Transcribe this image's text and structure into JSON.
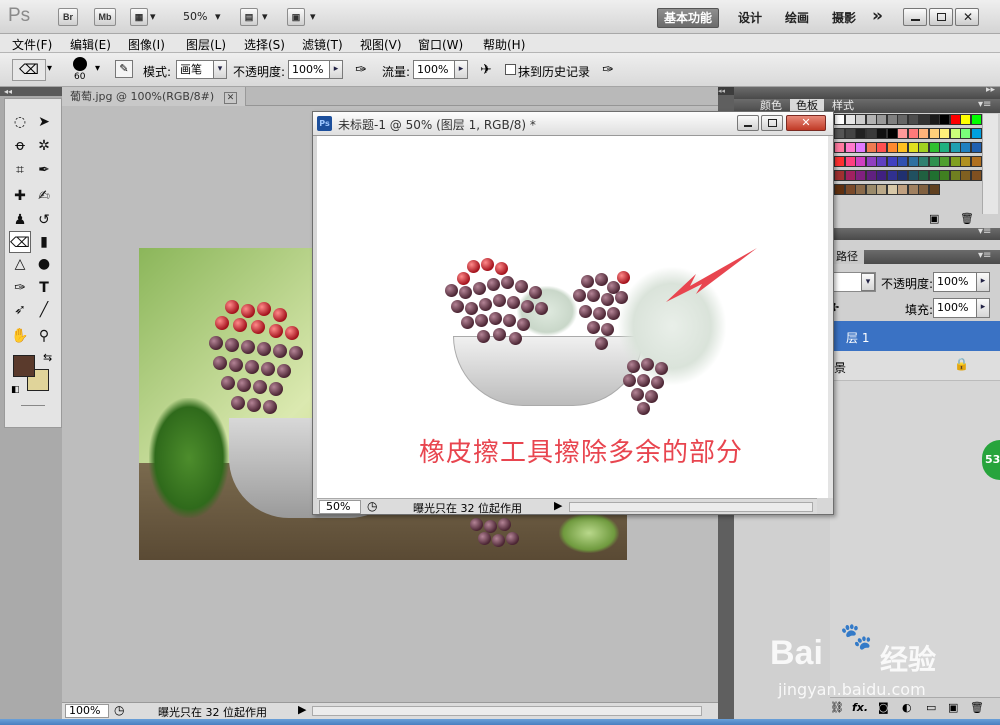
{
  "app": {
    "logo": "Ps",
    "bridge_btn": "Br",
    "minibridge_btn": "Mb",
    "zoom_level": "50%",
    "workspaces": [
      "基本功能",
      "设计",
      "绘画",
      "摄影"
    ],
    "more": "»"
  },
  "menu": [
    "文件(F)",
    "编辑(E)",
    "图像(I)",
    "图层(L)",
    "选择(S)",
    "滤镜(T)",
    "视图(V)",
    "窗口(W)",
    "帮助(H)"
  ],
  "options": {
    "brush_size": "60",
    "mode_label": "模式:",
    "mode_value": "画笔",
    "opacity_label": "不透明度:",
    "opacity_value": "100%",
    "flow_label": "流量:",
    "flow_value": "100%",
    "erase_history_label": "抹到历史记录"
  },
  "doc1": {
    "tab": "葡萄.jpg @ 100%(RGB/8#)",
    "zoom": "100%",
    "status": "曝光只在 32 位起作用"
  },
  "doc2": {
    "title": "未标题-1 @ 50% (图层 1, RGB/8) *",
    "annotation": "橡皮擦工具擦除多余的部分",
    "zoom": "50%",
    "status": "曝光只在 32 位起作用"
  },
  "panels": {
    "top_tabs": [
      "颜色",
      "色板",
      "样式"
    ],
    "layer_tab": "路径",
    "layer_opacity_label": "不透明度:",
    "layer_opacity_value": "100%",
    "fill_label": "填充:",
    "fill_value": "100%",
    "layer1_name": "层 1",
    "background_name": "景"
  },
  "badge": "53",
  "watermark": {
    "brand": "Bai",
    "brand_suffix": "经验",
    "url": "jingyan.baidu.com"
  },
  "colors": {
    "foreground": "#5a3a2c",
    "background": "#e0d49a",
    "layer_selected": "#3a72c4",
    "annotation": "#e8454f"
  }
}
